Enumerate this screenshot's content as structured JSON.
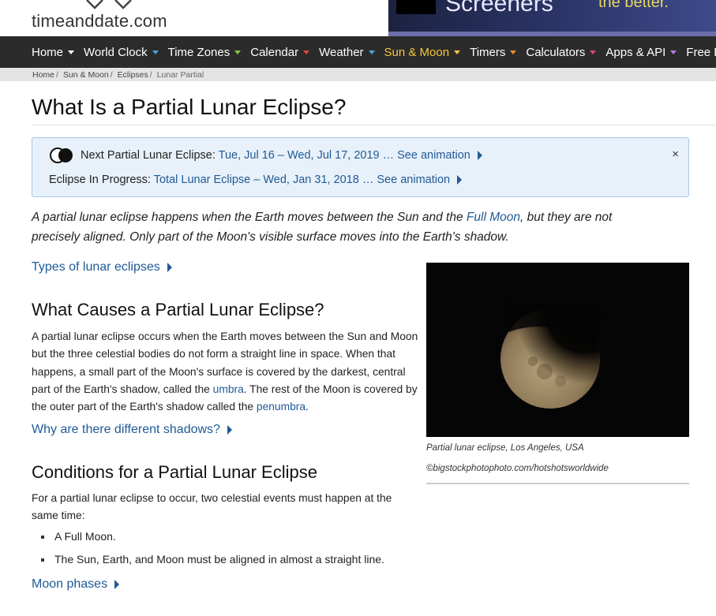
{
  "logo": {
    "text": "timeanddate.com"
  },
  "ad": {
    "headline": "Screeners",
    "tagline": "the better."
  },
  "nav": {
    "items": [
      {
        "label": "Home",
        "caret": "#ffffff"
      },
      {
        "label": "World Clock",
        "caret": "#4aa3df"
      },
      {
        "label": "Time Zones",
        "caret": "#8cc63f"
      },
      {
        "label": "Calendar",
        "caret": "#e8453c"
      },
      {
        "label": "Weather",
        "caret": "#4aa3df"
      },
      {
        "label": "Sun & Moon",
        "caret": "#f5c63c",
        "active": true
      },
      {
        "label": "Timers",
        "caret": "#f08c2e"
      },
      {
        "label": "Calculators",
        "caret": "#e0437a"
      },
      {
        "label": "Apps & API",
        "caret": "#b57be0"
      },
      {
        "label": "Free Fun",
        "caret": "#8cc63f"
      }
    ]
  },
  "breadcrumb": {
    "items": [
      "Home",
      "Sun & Moon",
      "Eclipses"
    ],
    "current": "Lunar Partial"
  },
  "page_title": "What Is a Partial Lunar Eclipse?",
  "info_box": {
    "next_label": "Next Partial Lunar Eclipse:",
    "next_link": "Tue, Jul 16 – Wed, Jul 17, 2019 … See animation",
    "progress_label": "Eclipse In Progress:",
    "progress_link": "Total Lunar Eclipse – Wed, Jan 31, 2018 … See animation",
    "close": "×"
  },
  "intro": {
    "before": "A partial lunar eclipse happens when the Earth moves between the Sun and the ",
    "link": "Full Moon",
    "after": ", but they are not precisely aligned. Only part of the Moon's visible surface moves into the Earth's shadow."
  },
  "links": {
    "types": "Types of lunar eclipses",
    "shadows": "Why are there different shadows?",
    "phases": "Moon phases"
  },
  "section1": {
    "title": "What Causes a Partial Lunar Eclipse?",
    "text_a": "A partial lunar eclipse occurs when the Earth moves between the Sun and Moon but the three celestial bodies do not form a straight line in space. When that happens, a small part of the Moon's surface is covered by the darkest, central part of the Earth's shadow, called the ",
    "link_umbra": "umbra",
    "text_b": ". The rest of the Moon is covered by the outer part of the Earth's shadow called the ",
    "link_penumbra": "penumbra",
    "text_c": "."
  },
  "photo": {
    "caption": "Partial lunar eclipse, Los Angeles, USA",
    "credit": "©bigstockphotophoto.com/hotshotsworldwide"
  },
  "section2": {
    "title": "Conditions for a Partial Lunar Eclipse",
    "text": "For a partial lunar eclipse to occur, two celestial events must happen at the same time:",
    "bullets": [
      "A Full Moon.",
      "The Sun, Earth, and Moon must be aligned in almost a straight line."
    ]
  }
}
